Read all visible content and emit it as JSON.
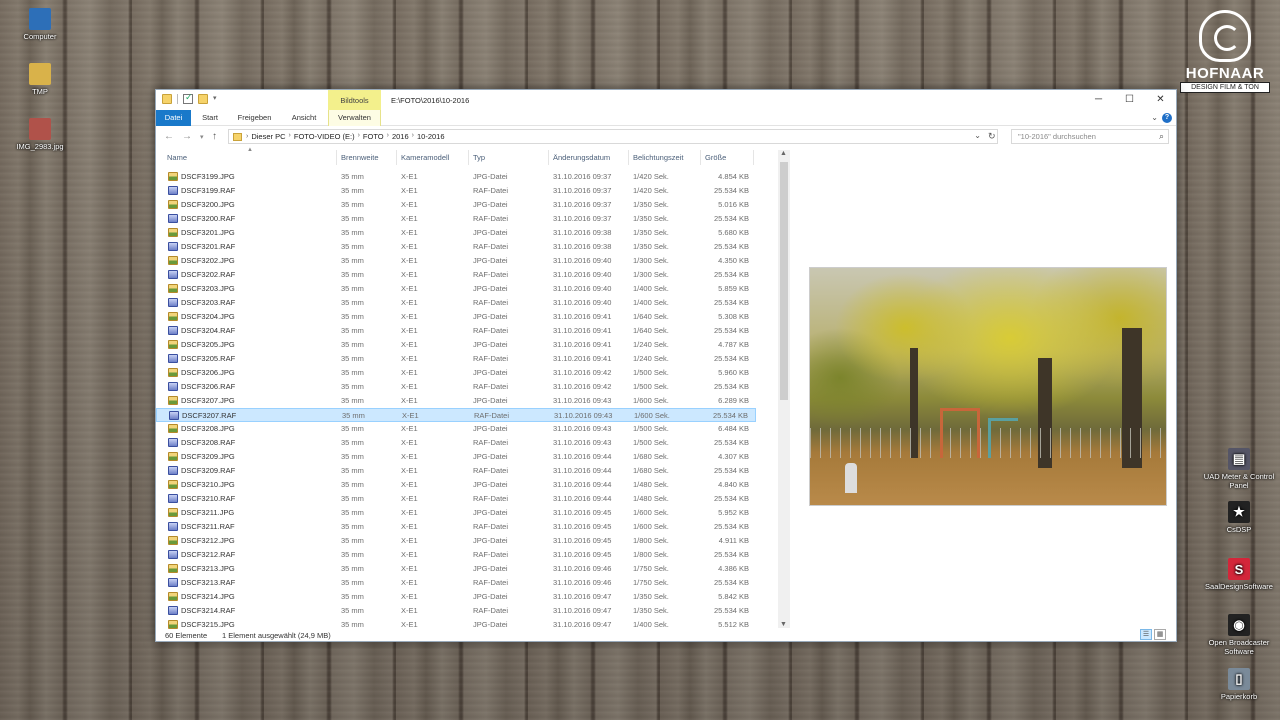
{
  "desktop": {
    "icons_left": [
      {
        "label": "Computer",
        "icon": "computer-icon"
      },
      {
        "label": "TMP",
        "icon": "folder-icon"
      },
      {
        "label": "IMG_2983.jpg",
        "icon": "image-file-icon"
      }
    ],
    "icons_right": [
      {
        "label": "UAD Meter & Control Panel",
        "icon": "uad-meter-icon"
      },
      {
        "label": "CsDSP",
        "icon": "csdsp-icon"
      },
      {
        "label": "SaalDesignSoftware",
        "icon": "saaldesign-icon"
      },
      {
        "label": "Open Broadcaster Software",
        "icon": "obs-icon"
      },
      {
        "label": "Papierkorb",
        "icon": "recycle-bin-icon"
      }
    ],
    "logo": {
      "brand": "HOFNAAR",
      "sub": "DESIGN FILM & TON"
    }
  },
  "window": {
    "title_path": "E:\\FOTO\\2016\\10-2016",
    "contextual_tab": "Bildtools",
    "ribbon_tabs": [
      "Datei",
      "Start",
      "Freigeben",
      "Ansicht",
      "Verwalten"
    ],
    "breadcrumb": [
      "Dieser PC",
      "FOTO-VIDEO (E:)",
      "FOTO",
      "2016",
      "10-2016"
    ],
    "search_placeholder": "\"10-2016\" durchsuchen",
    "columns": [
      "Name",
      "Brennweite",
      "Kameramodell",
      "Typ",
      "Änderungsdatum",
      "Belichtungszeit",
      "Größe"
    ],
    "selected_index": 17,
    "files": [
      [
        "DSCF3199.JPG",
        "35 mm",
        "X-E1",
        "JPG-Datei",
        "31.10.2016 09:37",
        "1/420 Sek.",
        "4.854 KB"
      ],
      [
        "DSCF3199.RAF",
        "35 mm",
        "X-E1",
        "RAF-Datei",
        "31.10.2016 09:37",
        "1/420 Sek.",
        "25.534 KB"
      ],
      [
        "DSCF3200.JPG",
        "35 mm",
        "X-E1",
        "JPG-Datei",
        "31.10.2016 09:37",
        "1/350 Sek.",
        "5.016 KB"
      ],
      [
        "DSCF3200.RAF",
        "35 mm",
        "X-E1",
        "RAF-Datei",
        "31.10.2016 09:37",
        "1/350 Sek.",
        "25.534 KB"
      ],
      [
        "DSCF3201.JPG",
        "35 mm",
        "X-E1",
        "JPG-Datei",
        "31.10.2016 09:38",
        "1/350 Sek.",
        "5.680 KB"
      ],
      [
        "DSCF3201.RAF",
        "35 mm",
        "X-E1",
        "RAF-Datei",
        "31.10.2016 09:38",
        "1/350 Sek.",
        "25.534 KB"
      ],
      [
        "DSCF3202.JPG",
        "35 mm",
        "X-E1",
        "JPG-Datei",
        "31.10.2016 09:40",
        "1/300 Sek.",
        "4.350 KB"
      ],
      [
        "DSCF3202.RAF",
        "35 mm",
        "X-E1",
        "RAF-Datei",
        "31.10.2016 09:40",
        "1/300 Sek.",
        "25.534 KB"
      ],
      [
        "DSCF3203.JPG",
        "35 mm",
        "X-E1",
        "JPG-Datei",
        "31.10.2016 09:40",
        "1/400 Sek.",
        "5.859 KB"
      ],
      [
        "DSCF3203.RAF",
        "35 mm",
        "X-E1",
        "RAF-Datei",
        "31.10.2016 09:40",
        "1/400 Sek.",
        "25.534 KB"
      ],
      [
        "DSCF3204.JPG",
        "35 mm",
        "X-E1",
        "JPG-Datei",
        "31.10.2016 09:41",
        "1/640 Sek.",
        "5.308 KB"
      ],
      [
        "DSCF3204.RAF",
        "35 mm",
        "X-E1",
        "RAF-Datei",
        "31.10.2016 09:41",
        "1/640 Sek.",
        "25.534 KB"
      ],
      [
        "DSCF3205.JPG",
        "35 mm",
        "X-E1",
        "JPG-Datei",
        "31.10.2016 09:41",
        "1/240 Sek.",
        "4.787 KB"
      ],
      [
        "DSCF3205.RAF",
        "35 mm",
        "X-E1",
        "RAF-Datei",
        "31.10.2016 09:41",
        "1/240 Sek.",
        "25.534 KB"
      ],
      [
        "DSCF3206.JPG",
        "35 mm",
        "X-E1",
        "JPG-Datei",
        "31.10.2016 09:42",
        "1/500 Sek.",
        "5.960 KB"
      ],
      [
        "DSCF3206.RAF",
        "35 mm",
        "X-E1",
        "RAF-Datei",
        "31.10.2016 09:42",
        "1/500 Sek.",
        "25.534 KB"
      ],
      [
        "DSCF3207.JPG",
        "35 mm",
        "X-E1",
        "JPG-Datei",
        "31.10.2016 09:43",
        "1/600 Sek.",
        "6.289 KB"
      ],
      [
        "DSCF3207.RAF",
        "35 mm",
        "X-E1",
        "RAF-Datei",
        "31.10.2016 09:43",
        "1/600 Sek.",
        "25.534 KB"
      ],
      [
        "DSCF3208.JPG",
        "35 mm",
        "X-E1",
        "JPG-Datei",
        "31.10.2016 09:43",
        "1/500 Sek.",
        "6.484 KB"
      ],
      [
        "DSCF3208.RAF",
        "35 mm",
        "X-E1",
        "RAF-Datei",
        "31.10.2016 09:43",
        "1/500 Sek.",
        "25.534 KB"
      ],
      [
        "DSCF3209.JPG",
        "35 mm",
        "X-E1",
        "JPG-Datei",
        "31.10.2016 09:44",
        "1/680 Sek.",
        "4.307 KB"
      ],
      [
        "DSCF3209.RAF",
        "35 mm",
        "X-E1",
        "RAF-Datei",
        "31.10.2016 09:44",
        "1/680 Sek.",
        "25.534 KB"
      ],
      [
        "DSCF3210.JPG",
        "35 mm",
        "X-E1",
        "JPG-Datei",
        "31.10.2016 09:44",
        "1/480 Sek.",
        "4.840 KB"
      ],
      [
        "DSCF3210.RAF",
        "35 mm",
        "X-E1",
        "RAF-Datei",
        "31.10.2016 09:44",
        "1/480 Sek.",
        "25.534 KB"
      ],
      [
        "DSCF3211.JPG",
        "35 mm",
        "X-E1",
        "JPG-Datei",
        "31.10.2016 09:45",
        "1/600 Sek.",
        "5.952 KB"
      ],
      [
        "DSCF3211.RAF",
        "35 mm",
        "X-E1",
        "RAF-Datei",
        "31.10.2016 09:45",
        "1/600 Sek.",
        "25.534 KB"
      ],
      [
        "DSCF3212.JPG",
        "35 mm",
        "X-E1",
        "JPG-Datei",
        "31.10.2016 09:45",
        "1/800 Sek.",
        "4.911 KB"
      ],
      [
        "DSCF3212.RAF",
        "35 mm",
        "X-E1",
        "RAF-Datei",
        "31.10.2016 09:45",
        "1/800 Sek.",
        "25.534 KB"
      ],
      [
        "DSCF3213.JPG",
        "35 mm",
        "X-E1",
        "JPG-Datei",
        "31.10.2016 09:46",
        "1/750 Sek.",
        "4.386 KB"
      ],
      [
        "DSCF3213.RAF",
        "35 mm",
        "X-E1",
        "RAF-Datei",
        "31.10.2016 09:46",
        "1/750 Sek.",
        "25.534 KB"
      ],
      [
        "DSCF3214.JPG",
        "35 mm",
        "X-E1",
        "JPG-Datei",
        "31.10.2016 09:47",
        "1/350 Sek.",
        "5.842 KB"
      ],
      [
        "DSCF3214.RAF",
        "35 mm",
        "X-E1",
        "RAF-Datei",
        "31.10.2016 09:47",
        "1/350 Sek.",
        "25.534 KB"
      ],
      [
        "DSCF3215.JPG",
        "35 mm",
        "X-E1",
        "JPG-Datei",
        "31.10.2016 09:47",
        "1/400 Sek.",
        "5.512 KB"
      ]
    ],
    "status": {
      "count": "60 Elemente",
      "selection": "1 Element ausgewählt (24,9 MB)"
    }
  }
}
